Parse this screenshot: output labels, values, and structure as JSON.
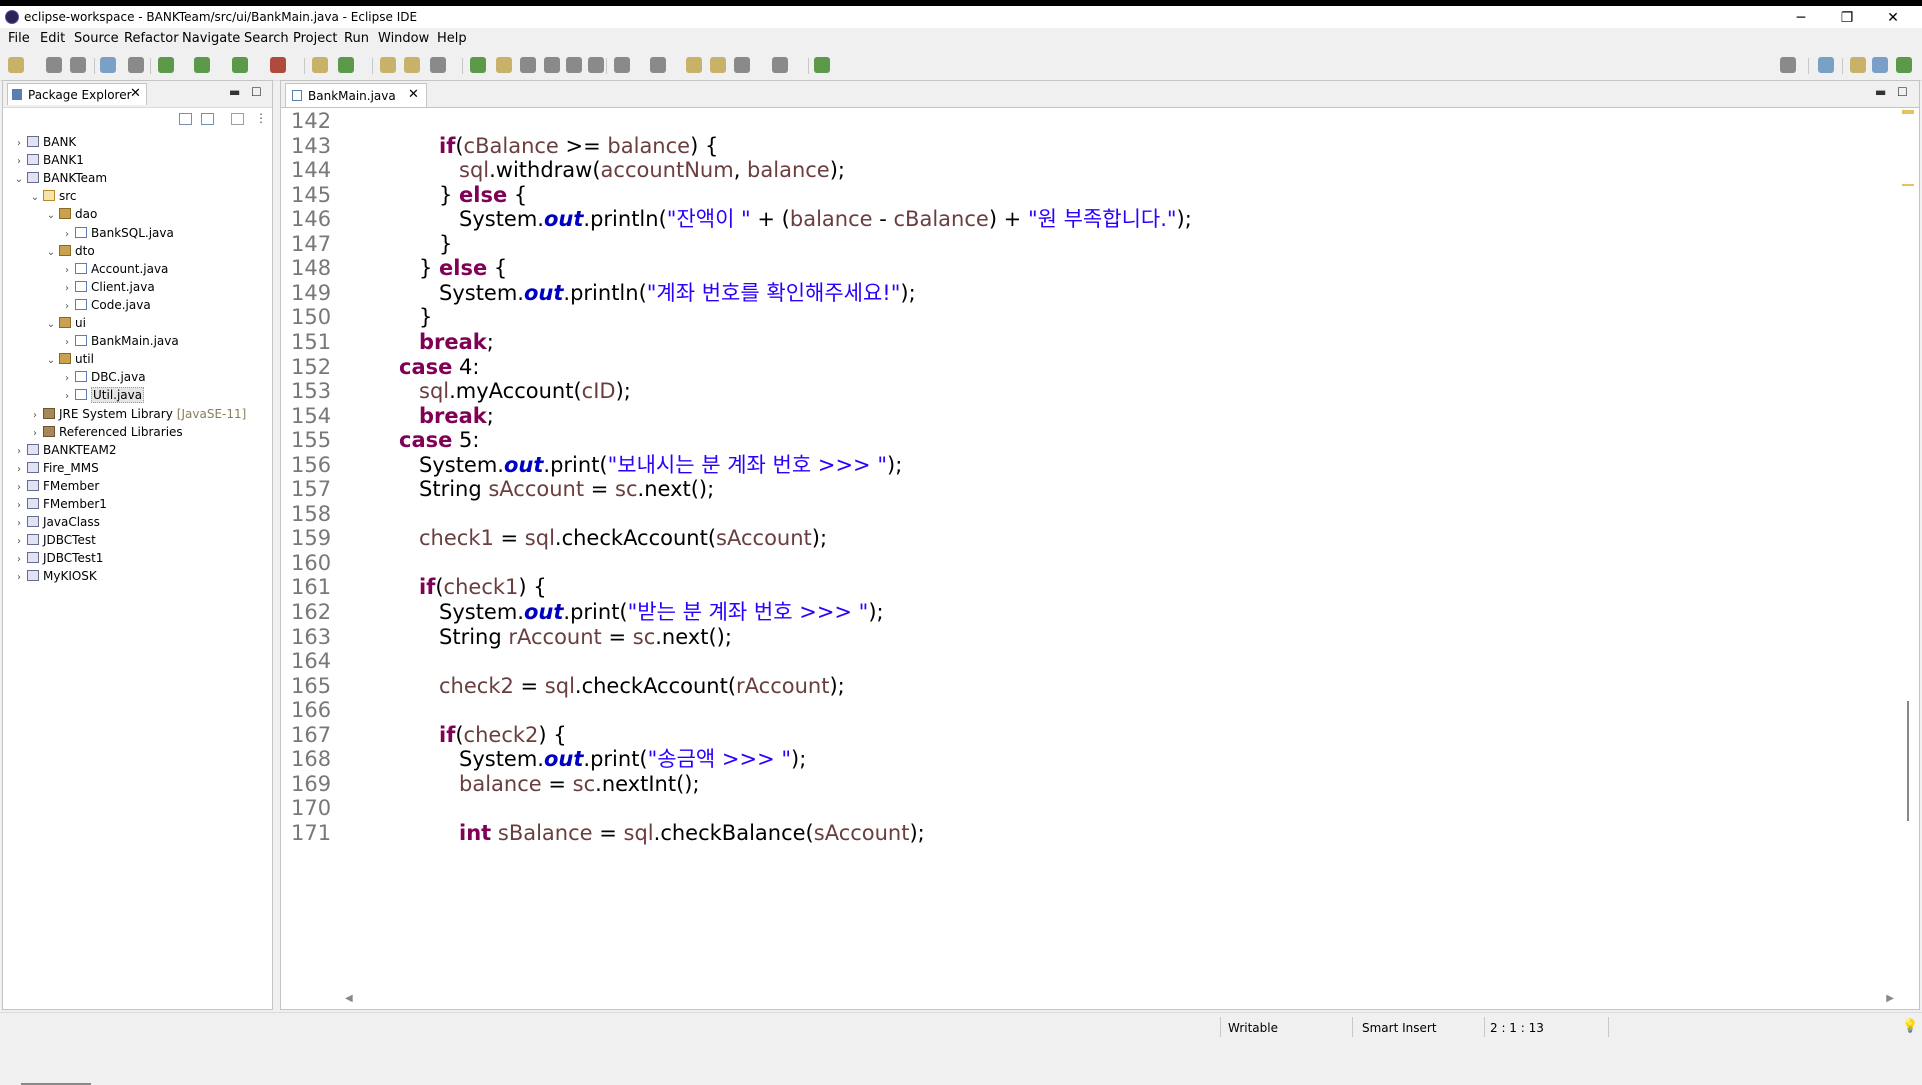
{
  "window": {
    "title": "eclipse-workspace - BANKTeam/src/ui/BankMain.java - Eclipse IDE",
    "controls": {
      "minimize": "─",
      "restore": "❐",
      "close": "✕"
    }
  },
  "menubar": [
    "File",
    "Edit",
    "Source",
    "Refactor",
    "Navigate",
    "Search",
    "Project",
    "Run",
    "Window",
    "Help"
  ],
  "package_explorer": {
    "tab_label": "Package Explorer",
    "close": "✕",
    "tree": [
      {
        "label": "BANK",
        "arrow": "›",
        "icon": "project"
      },
      {
        "label": "BANK1",
        "arrow": "›",
        "icon": "project"
      },
      {
        "label": "BANKTeam",
        "arrow": "⌄",
        "icon": "project"
      },
      {
        "label": "src",
        "arrow": "⌄",
        "icon": "src"
      },
      {
        "label": "dao",
        "arrow": "⌄",
        "icon": "pkg"
      },
      {
        "label": "BankSQL.java",
        "arrow": "›",
        "icon": "java"
      },
      {
        "label": "dto",
        "arrow": "⌄",
        "icon": "pkg"
      },
      {
        "label": "Account.java",
        "arrow": "›",
        "icon": "java"
      },
      {
        "label": "Client.java",
        "arrow": "›",
        "icon": "java"
      },
      {
        "label": "Code.java",
        "arrow": "›",
        "icon": "java"
      },
      {
        "label": "ui",
        "arrow": "⌄",
        "icon": "pkg"
      },
      {
        "label": "BankMain.java",
        "arrow": "›",
        "icon": "java"
      },
      {
        "label": "util",
        "arrow": "⌄",
        "icon": "pkg"
      },
      {
        "label": "DBC.java",
        "arrow": "›",
        "icon": "java"
      },
      {
        "label": "Util.java",
        "arrow": "›",
        "icon": "java",
        "selected": true
      },
      {
        "label": "JRE System Library",
        "extra": "[JavaSE-11]",
        "arrow": "›",
        "icon": "lib"
      },
      {
        "label": "Referenced Libraries",
        "arrow": "›",
        "icon": "lib"
      },
      {
        "label": "BANKTEAM2",
        "arrow": "›",
        "icon": "project"
      },
      {
        "label": "Fire_MMS",
        "arrow": "›",
        "icon": "project"
      },
      {
        "label": "FMember",
        "arrow": "›",
        "icon": "project"
      },
      {
        "label": "FMember1",
        "arrow": "›",
        "icon": "project"
      },
      {
        "label": "JavaClass",
        "arrow": "›",
        "icon": "project"
      },
      {
        "label": "JDBCTest",
        "arrow": "›",
        "icon": "project"
      },
      {
        "label": "JDBCTest1",
        "arrow": "›",
        "icon": "project"
      },
      {
        "label": "MyKIOSK",
        "arrow": "›",
        "icon": "project"
      }
    ]
  },
  "editor": {
    "tab_label": "BankMain.java",
    "close": "✕",
    "line_numbers": [
      "142",
      "143",
      "144",
      "145",
      "146",
      "147",
      "148",
      "149",
      "150",
      "151",
      "152",
      "153",
      "154",
      "155",
      "156",
      "157",
      "158",
      "159",
      "160",
      "161",
      "162",
      "163",
      "164",
      "165",
      "166",
      "167",
      "168",
      "169",
      "170",
      "171"
    ],
    "lines": [
      [],
      [
        {
          "t": "if",
          "c": "kw"
        },
        {
          "t": "("
        },
        {
          "t": "cBalance",
          "c": "var"
        },
        {
          "t": " >= "
        },
        {
          "t": "balance",
          "c": "var"
        },
        {
          "t": ") {"
        }
      ],
      [
        {
          "t": "sql",
          "c": "var"
        },
        {
          "t": ".withdraw("
        },
        {
          "t": "accountNum",
          "c": "var"
        },
        {
          "t": ", "
        },
        {
          "t": "balance",
          "c": "var"
        },
        {
          "t": ");"
        }
      ],
      [
        {
          "t": "} "
        },
        {
          "t": "else",
          "c": "kw"
        },
        {
          "t": " {"
        }
      ],
      [
        {
          "t": "System."
        },
        {
          "t": "out",
          "c": "fld"
        },
        {
          "t": ".println("
        },
        {
          "t": "\"잔액이 \"",
          "c": "str"
        },
        {
          "t": " + ("
        },
        {
          "t": "balance",
          "c": "var"
        },
        {
          "t": " - "
        },
        {
          "t": "cBalance",
          "c": "var"
        },
        {
          "t": ") + "
        },
        {
          "t": "\"원 부족합니다.\"",
          "c": "str"
        },
        {
          "t": ");"
        }
      ],
      [
        {
          "t": "}"
        }
      ],
      [
        {
          "t": "} "
        },
        {
          "t": "else",
          "c": "kw"
        },
        {
          "t": " {"
        }
      ],
      [
        {
          "t": "System."
        },
        {
          "t": "out",
          "c": "fld"
        },
        {
          "t": ".println("
        },
        {
          "t": "\"계좌 번호를 확인해주세요!\"",
          "c": "str"
        },
        {
          "t": ");"
        }
      ],
      [
        {
          "t": "}"
        }
      ],
      [
        {
          "t": "break",
          "c": "kw"
        },
        {
          "t": ";"
        }
      ],
      [
        {
          "t": "case",
          "c": "kw"
        },
        {
          "t": " 4:"
        }
      ],
      [
        {
          "t": "sql",
          "c": "var"
        },
        {
          "t": ".myAccount("
        },
        {
          "t": "cID",
          "c": "var"
        },
        {
          "t": ");"
        }
      ],
      [
        {
          "t": "break",
          "c": "kw"
        },
        {
          "t": ";"
        }
      ],
      [
        {
          "t": "case",
          "c": "kw"
        },
        {
          "t": " 5:"
        }
      ],
      [
        {
          "t": "System."
        },
        {
          "t": "out",
          "c": "fld"
        },
        {
          "t": ".print("
        },
        {
          "t": "\"보내시는 분 계좌 번호 >>> \"",
          "c": "str"
        },
        {
          "t": ");"
        }
      ],
      [
        {
          "t": "String "
        },
        {
          "t": "sAccount",
          "c": "lvar"
        },
        {
          "t": " = "
        },
        {
          "t": "sc",
          "c": "var"
        },
        {
          "t": ".next();"
        }
      ],
      [],
      [
        {
          "t": "check1",
          "c": "var"
        },
        {
          "t": " = "
        },
        {
          "t": "sql",
          "c": "var"
        },
        {
          "t": ".checkAccount("
        },
        {
          "t": "sAccount",
          "c": "lvar"
        },
        {
          "t": ");"
        }
      ],
      [],
      [
        {
          "t": "if",
          "c": "kw"
        },
        {
          "t": "("
        },
        {
          "t": "check1",
          "c": "var"
        },
        {
          "t": ") {"
        }
      ],
      [
        {
          "t": "System."
        },
        {
          "t": "out",
          "c": "fld"
        },
        {
          "t": ".print("
        },
        {
          "t": "\"받는 분 계좌 번호 >>> \"",
          "c": "str"
        },
        {
          "t": ");"
        }
      ],
      [
        {
          "t": "String "
        },
        {
          "t": "rAccount",
          "c": "lvar"
        },
        {
          "t": " = "
        },
        {
          "t": "sc",
          "c": "var"
        },
        {
          "t": ".next();"
        }
      ],
      [],
      [
        {
          "t": "check2",
          "c": "var"
        },
        {
          "t": " = "
        },
        {
          "t": "sql",
          "c": "var"
        },
        {
          "t": ".checkAccount("
        },
        {
          "t": "rAccount",
          "c": "lvar"
        },
        {
          "t": ");"
        }
      ],
      [],
      [
        {
          "t": "if",
          "c": "kw"
        },
        {
          "t": "("
        },
        {
          "t": "check2",
          "c": "var"
        },
        {
          "t": ") {"
        }
      ],
      [
        {
          "t": "System."
        },
        {
          "t": "out",
          "c": "fld"
        },
        {
          "t": ".print("
        },
        {
          "t": "\"송금액 >>> \"",
          "c": "str"
        },
        {
          "t": ");"
        }
      ],
      [
        {
          "t": "balance",
          "c": "var"
        },
        {
          "t": " = "
        },
        {
          "t": "sc",
          "c": "var"
        },
        {
          "t": ".nextInt();"
        }
      ],
      [],
      [
        {
          "t": "int",
          "c": "kw"
        },
        {
          "t": " "
        },
        {
          "t": "sBalance",
          "c": "lvar"
        },
        {
          "t": " = "
        },
        {
          "t": "sql",
          "c": "var"
        },
        {
          "t": ".checkBalance("
        },
        {
          "t": "sAccount",
          "c": "lvar"
        },
        {
          "t": ");"
        }
      ]
    ]
  },
  "statusbar": {
    "writable": "Writable",
    "insert_mode": "Smart Insert",
    "position": "2 : 1 : 13"
  }
}
